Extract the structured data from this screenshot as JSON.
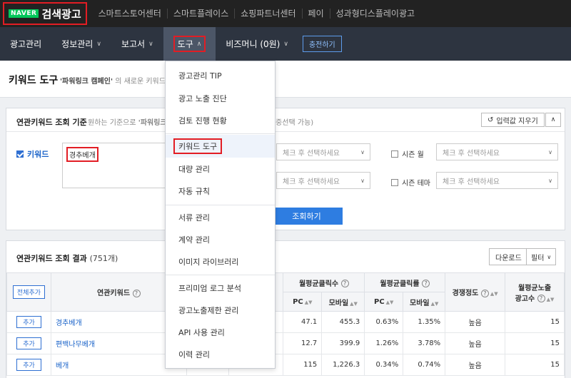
{
  "topbar": {
    "logo_naver": "NAVER",
    "logo_title": "검색광고",
    "links": [
      "스마트스토어센터",
      "스마트플레이스",
      "쇼핑파트너센터",
      "페이",
      "성과형디스플레이광고"
    ]
  },
  "nav": {
    "items": [
      {
        "label": "광고관리",
        "chevron": false
      },
      {
        "label": "정보관리",
        "chevron": true
      },
      {
        "label": "보고서",
        "chevron": true
      },
      {
        "label": "도구",
        "chevron": true
      },
      {
        "label": "비즈머니 (0원)",
        "chevron": true
      }
    ],
    "charge_label": "충전하기"
  },
  "page": {
    "title": "키워드 도구",
    "sub_bold": "'파워링크 캠페인'",
    "sub_rest": " 의 새로운 키워드"
  },
  "search_panel": {
    "title": "연관키워드 조회 기준",
    "subtitle_pre": "원하는 기준으로 ",
    "subtitle_bold": "'파워링크'",
    "subtitle_end": "(다중선택 가능)",
    "reset_label": "입력값 지우기",
    "keyword_label": "키워드",
    "keyword_value": "경추베개",
    "select_placeholder": "체크 후 선택하세요",
    "season_month_label": "시즌 월",
    "season_theme_label": "시즌 테마",
    "search_button": "조회하기"
  },
  "results": {
    "title": "연관키워드 조회 결과",
    "count": "(751개)",
    "download_label": "다운로드",
    "filter_label": "필터",
    "headers": {
      "add_all": "전체추가",
      "keyword": "연관키워드",
      "avg_clicks": "월평균클릭수",
      "avg_ctr": "월평균클릭률",
      "pc": "PC",
      "mobile": "모바일",
      "competition": "경쟁정도",
      "avg_ads_line1": "월평균노출",
      "avg_ads_line2": "광고수"
    },
    "add_label": "추가",
    "rows": [
      {
        "keyword": "경추베개",
        "pc_clicks": "47.1",
        "mo_clicks": "455.3",
        "pc_ctr": "0.63%",
        "mo_ctr": "1.35%",
        "competition": "높음",
        "ads": "15"
      },
      {
        "keyword": "편백나무베개",
        "pc_clicks": "12.7",
        "mo_clicks": "399.9",
        "pc_ctr": "1.26%",
        "mo_ctr": "3.78%",
        "competition": "높음",
        "ads": "15"
      },
      {
        "keyword": "베개",
        "pc_clicks": "115",
        "mo_clicks": "1,226.3",
        "pc_ctr": "0.34%",
        "mo_ctr": "0.74%",
        "competition": "높음",
        "ads": "15"
      }
    ]
  },
  "dropdown": {
    "items": [
      "광고관리 TIP",
      "광고 노출 진단",
      "검토 진행 현황",
      "키워드 도구",
      "대량 관리",
      "자동 규칙",
      "서류 관리",
      "계약 관리",
      "이미지 라이브러리",
      "프리미엄 로그 분석",
      "광고노출제한 관리",
      "API 사용 관리",
      "이력 관리"
    ],
    "active_index": 3
  },
  "colors": {
    "accent": "#2e7de1",
    "highlight": "#e21d24",
    "nav_bg": "#2d3440",
    "top_bg": "#222222"
  }
}
